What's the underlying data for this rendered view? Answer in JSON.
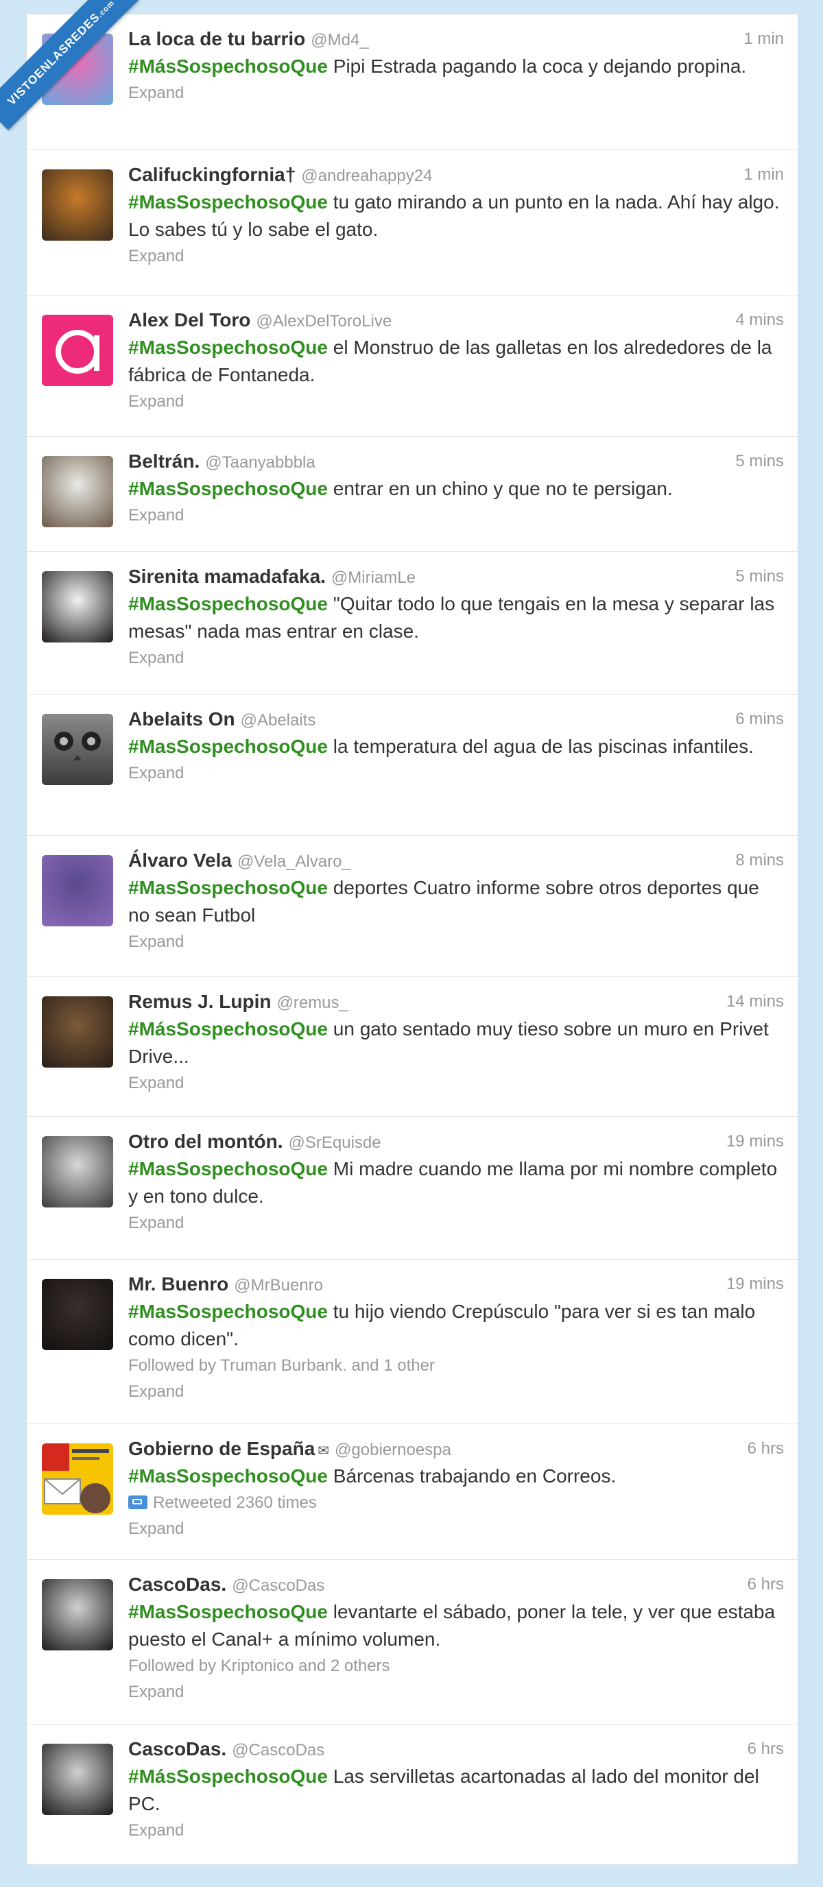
{
  "watermark": {
    "main": "VISTOENLASREDES",
    "sub": ".com"
  },
  "tweets": [
    {
      "name": "La loca de tu barrio",
      "handle": "@Md4_",
      "time": "1 min",
      "hashtag": "#MásSospechosoQue",
      "text": " Pipi Estrada pagando la coca y dejando propina.",
      "extra": "",
      "expand": "Expand",
      "avatar_colors": [
        "#e86fb6",
        "#6aa8e0"
      ],
      "avatar_icon": "profile-photo-icon"
    },
    {
      "name": "Califuckingfornia†",
      "handle": "@andreahappy24",
      "time": "1 min",
      "hashtag": "#MasSospechosoQue",
      "text": " tu gato mirando a un punto en la nada. Ahí hay algo. Lo sabes tú y lo sabe el gato.",
      "extra": "",
      "expand": "Expand",
      "avatar_colors": [
        "#c77b2a",
        "#3a2b1c"
      ],
      "avatar_icon": "profile-photo-icon"
    },
    {
      "name": "Alex Del Toro",
      "handle": "@AlexDelToroLive",
      "time": "4 mins",
      "hashtag": "#MasSospechosoQue",
      "text": " el Monstruo de las galletas en los alrededores de la fábrica de Fontaneda.",
      "extra": "",
      "expand": "Expand",
      "avatar_colors": [
        "#ee2b7a",
        "#ee2b7a"
      ],
      "avatar_icon": "letter-a-logo-icon"
    },
    {
      "name": "Beltrán.",
      "handle": "@Taanyabbbla",
      "time": "5 mins",
      "hashtag": "#MasSospechosoQue",
      "text": " entrar en un chino y que no te persigan.",
      "extra": "",
      "expand": "Expand",
      "avatar_colors": [
        "#e9e9e4",
        "#6b5a4a"
      ],
      "avatar_icon": "profile-photo-icon"
    },
    {
      "name": "Sirenita mamadafaka.",
      "handle": "@MiriamLe",
      "time": "5 mins",
      "hashtag": "#MasSospechosoQue",
      "text": " \"Quitar todo lo que tengais en la mesa y separar las mesas\" nada mas entrar en clase.",
      "extra": "",
      "expand": "Expand",
      "avatar_colors": [
        "#f2f2f2",
        "#1e1a1a"
      ],
      "avatar_icon": "profile-photo-icon"
    },
    {
      "name": "Abelaits On",
      "handle": "@Abelaits",
      "time": "6 mins",
      "hashtag": "#MasSospechosoQue",
      "text": " la temperatura del agua de las piscinas infantiles.",
      "extra": "",
      "expand": "Expand",
      "avatar_colors": [
        "#8a8a8a",
        "#3c3c3c"
      ],
      "avatar_icon": "cat-photo-icon"
    },
    {
      "name": "Álvaro Vela",
      "handle": "@Vela_Alvaro_",
      "time": "8 mins",
      "hashtag": "#MasSospechosoQue",
      "text": " deportes Cuatro informe sobre otros deportes que no sean Futbol",
      "extra": "",
      "expand": "Expand",
      "avatar_colors": [
        "#5a4a8c",
        "#8a6ab8"
      ],
      "avatar_icon": "profile-photo-icon"
    },
    {
      "name": "Remus J. Lupin",
      "handle": "@remus_",
      "time": "14 mins",
      "hashtag": "#MásSospechosoQue",
      "text": " un gato sentado muy tieso sobre un muro en Privet Drive...",
      "extra": "",
      "expand": "Expand",
      "avatar_colors": [
        "#7a5a3a",
        "#2a1e16"
      ],
      "avatar_icon": "profile-photo-icon"
    },
    {
      "name": "Otro del montón.",
      "handle": "@SrEquisde",
      "time": "19 mins",
      "hashtag": "#MasSospechosoQue",
      "text": " Mi madre cuando me llama por mi nombre completo y en tono dulce.",
      "extra": "",
      "expand": "Expand",
      "avatar_colors": [
        "#d8d8d8",
        "#3a3a3a"
      ],
      "avatar_icon": "profile-photo-icon"
    },
    {
      "name": "Mr. Buenro",
      "handle": "@MrBuenro",
      "time": "19 mins",
      "hashtag": "#MasSospechosoQue",
      "text": " tu hijo viendo Crepúsculo \"para ver si es tan malo como dicen\".",
      "extra": "Followed by Truman Burbank. and 1 other",
      "extra_type": "follow",
      "expand": "Expand",
      "avatar_colors": [
        "#3a2e2a",
        "#111111"
      ],
      "avatar_icon": "profile-photo-icon"
    },
    {
      "name": "Gobierno de España",
      "badge": "✉",
      "handle": "@gobiernoespa",
      "time": "6 hrs",
      "hashtag": "#MasSospechosoQue",
      "text": " Bárcenas trabajando en Correos.",
      "extra": "Retweeted 2360 times",
      "extra_type": "retweet",
      "expand": "Expand",
      "avatar_colors": [
        "#f6c400",
        "#d42a1e"
      ],
      "avatar_icon": "government-logo-icon"
    },
    {
      "name": "CascoDas.",
      "handle": "@CascoDas",
      "time": "6 hrs",
      "hashtag": "#MasSospechosoQue",
      "text": " levantarte el sábado, poner la tele, y ver que estaba puesto el Canal+ a mínimo volumen.",
      "extra": "Followed by Kriptonico and 2 others",
      "extra_type": "follow",
      "expand": "Expand",
      "avatar_colors": [
        "#d0d0d0",
        "#1a1a1a"
      ],
      "avatar_icon": "profile-photo-icon"
    },
    {
      "name": "CascoDas.",
      "handle": "@CascoDas",
      "time": "6 hrs",
      "hashtag": "#MásSospechosoQue",
      "text": " Las servilletas acartonadas al lado del monitor del PC.",
      "extra": "",
      "expand": "Expand",
      "avatar_colors": [
        "#d0d0d0",
        "#1a1a1a"
      ],
      "avatar_icon": "profile-photo-icon"
    }
  ]
}
